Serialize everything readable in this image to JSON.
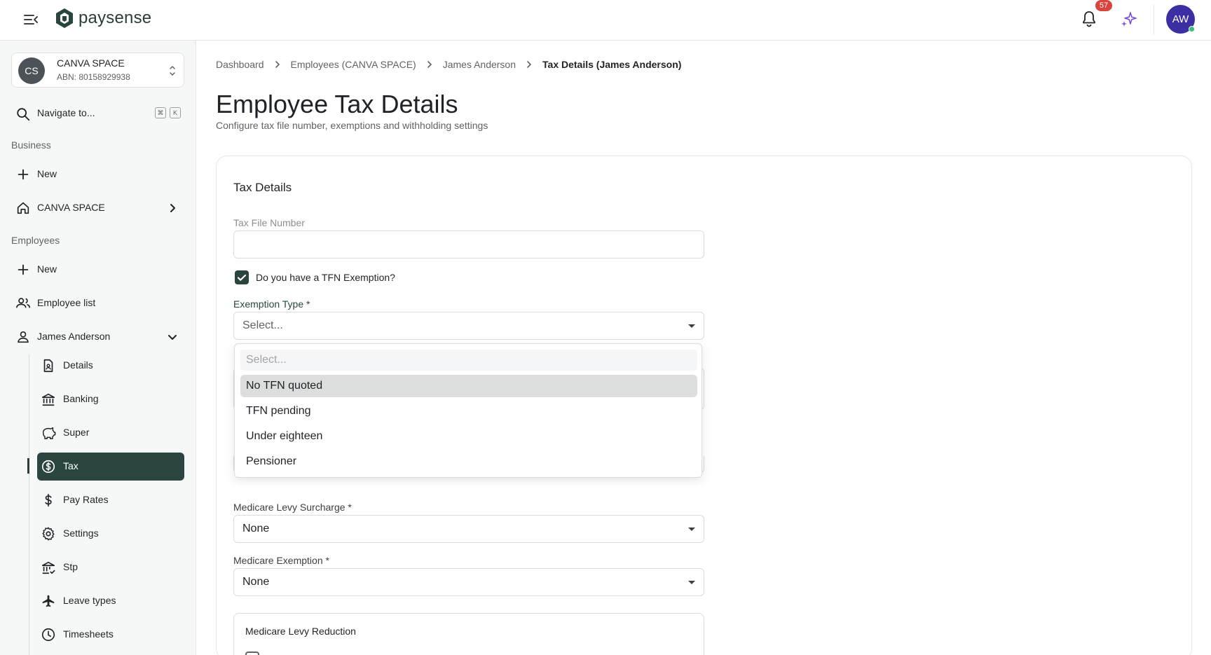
{
  "app": {
    "logo_text": "paysense",
    "notifications_count": "57",
    "user_initials": "AW"
  },
  "sidebar": {
    "org": {
      "initials": "CS",
      "name": "CANVA SPACE",
      "abn": "ABN: 80158929938"
    },
    "navigate": {
      "label": "Navigate to...",
      "kbd_1": "⌘",
      "kbd_2": "K"
    },
    "business_label": "Business",
    "business_items": [
      {
        "label": "New",
        "icon": "plus-icon"
      },
      {
        "label": "CANVA SPACE",
        "icon": "home-icon"
      }
    ],
    "employees_label": "Employees",
    "employee_items": [
      {
        "label": "New",
        "icon": "plus-icon"
      },
      {
        "label": "Employee list",
        "icon": "people-icon"
      },
      {
        "label": "James Anderson",
        "icon": "person-icon"
      }
    ],
    "employee_sub_items": [
      {
        "label": "Details",
        "icon": "document-icon"
      },
      {
        "label": "Banking",
        "icon": "bank-icon"
      },
      {
        "label": "Super",
        "icon": "piggy-bank-icon"
      },
      {
        "label": "Tax",
        "icon": "dollar-circle-icon",
        "active": true
      },
      {
        "label": "Pay Rates",
        "icon": "dollar-icon"
      },
      {
        "label": "Settings",
        "icon": "gear-icon"
      },
      {
        "label": "Stp",
        "icon": "bank-check-icon"
      },
      {
        "label": "Leave types",
        "icon": "airplane-icon"
      },
      {
        "label": "Timesheets",
        "icon": "clock-icon"
      }
    ]
  },
  "breadcrumb": [
    "Dashboard",
    "Employees (CANVA SPACE)",
    "James Anderson",
    "Tax Details (James Anderson)"
  ],
  "page": {
    "title": "Employee Tax Details",
    "subtitle": "Configure tax file number, exemptions and withholding settings"
  },
  "form": {
    "card_title": "Tax Details",
    "tfn_label": "Tax File Number",
    "tfn_value": "",
    "tfn_exemption_label": "Do you have a TFN Exemption?",
    "tfn_exemption_checked": true,
    "exemption_type_label": "Exemption Type *",
    "exemption_type_value": "Select...",
    "medicare_surcharge_label": "Medicare Levy Surcharge *",
    "medicare_surcharge_value": "None",
    "medicare_exemption_label": "Medicare Exemption *",
    "medicare_exemption_value": "None",
    "medicare_reduction_title": "Medicare Levy Reduction"
  },
  "dropdown": {
    "search_placeholder": "Select...",
    "options": [
      "No TFN quoted",
      "TFN pending",
      "Under eighteen",
      "Pensioner"
    ],
    "highlighted_index": 0
  },
  "colors": {
    "brand": "#2a453f",
    "avatar": "#3b2fa3",
    "badge": "#d9443f",
    "sparkle": "#7c4ddb"
  }
}
